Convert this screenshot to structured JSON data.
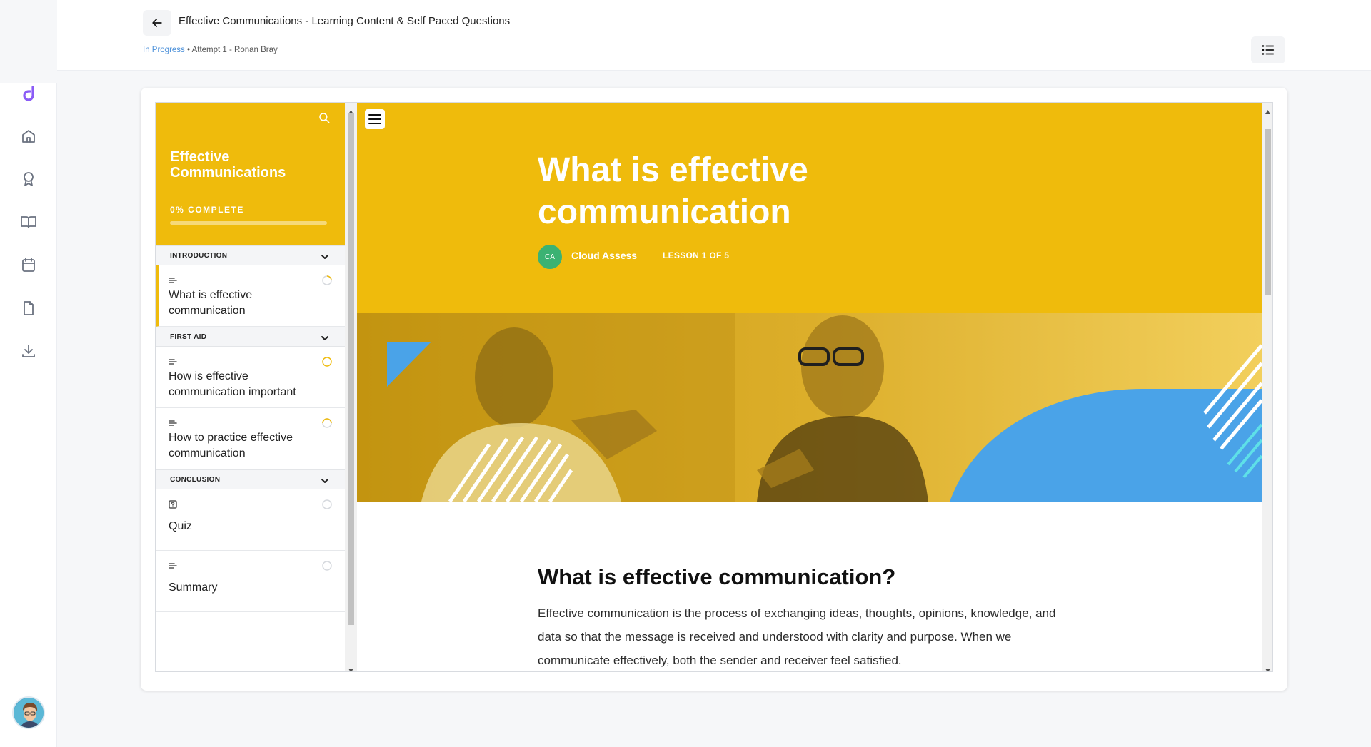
{
  "header": {
    "title": "Effective Communications - Learning Content & Self Paced Questions",
    "status": "In Progress",
    "attempt": " • Attempt 1 - Ronan Bray"
  },
  "rail": {
    "items": [
      "logo-icon",
      "home-icon",
      "award-icon",
      "book-icon",
      "calendar-icon",
      "file-icon",
      "download-icon"
    ]
  },
  "course": {
    "title": "Effective Communications",
    "progress_label": "0% COMPLETE",
    "progress_fraction": 0,
    "sections": [
      {
        "label": "INTRODUCTION",
        "items": [
          {
            "type": "text-icon",
            "title": "What is effective communication",
            "active": true
          }
        ]
      },
      {
        "label": "FIRST AID",
        "items": [
          {
            "type": "text-icon",
            "title": "How is effective communication important"
          },
          {
            "type": "text-icon",
            "title": "How to practice effective communication"
          }
        ]
      },
      {
        "label": "CONCLUSION",
        "items": [
          {
            "type": "quiz-icon",
            "title": "Quiz"
          },
          {
            "type": "text-icon",
            "title": "Summary"
          }
        ]
      }
    ]
  },
  "lesson": {
    "title": "What is effective communication",
    "author_initials": "CA",
    "author": "Cloud Assess",
    "counter": "LESSON 1 OF 5",
    "heading": "What is effective communication?",
    "paragraph": "Effective communication is the process of exchanging ideas, thoughts, opinions, knowledge, and data so that the message is received and understood with clarity and purpose. When we communicate effectively, both the sender and receiver feel satisfied."
  },
  "colors": {
    "accent": "#efbb0c",
    "brand_logo": "#8b5cf6",
    "status_link": "#4a8fd9",
    "banner_blue": "#4aa3e8"
  }
}
